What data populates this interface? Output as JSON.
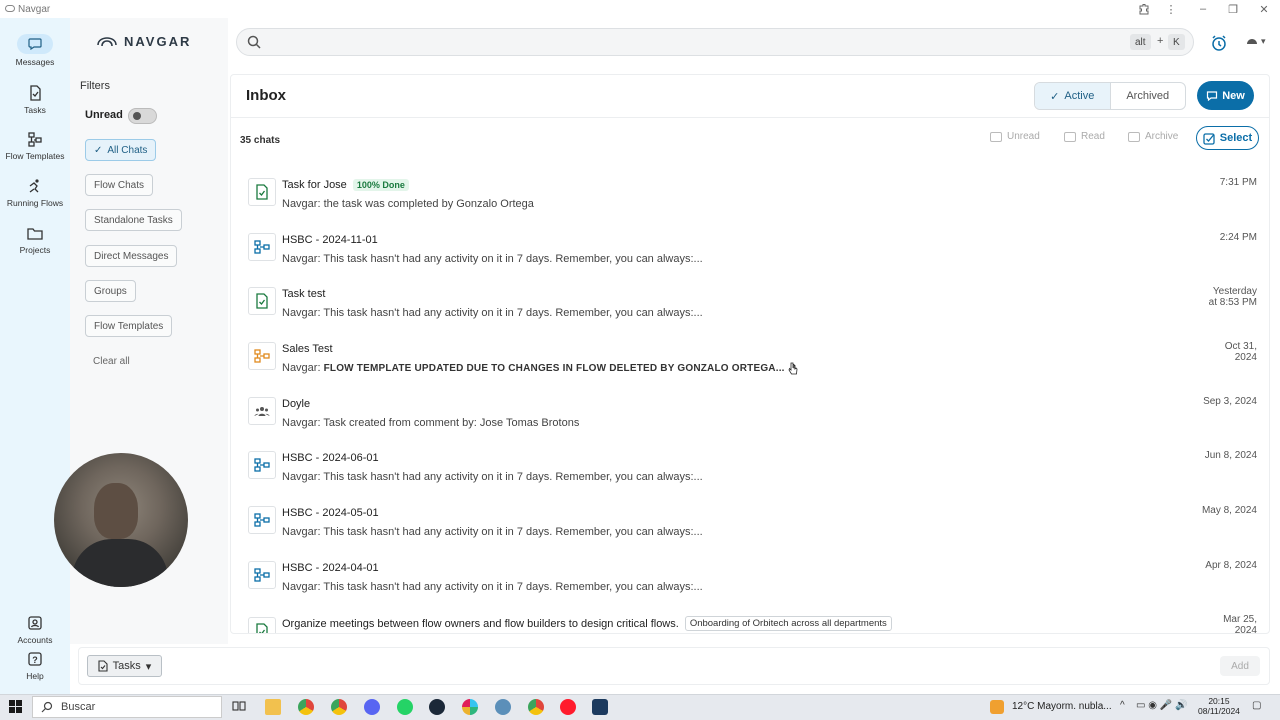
{
  "window": {
    "title": "Navgar"
  },
  "rail": {
    "items": [
      {
        "label": "Messages",
        "icon": "message-icon"
      },
      {
        "label": "Tasks",
        "icon": "task-icon"
      },
      {
        "label": "Flow Templates",
        "icon": "flow-template-icon"
      },
      {
        "label": "Running Flows",
        "icon": "running-flow-icon"
      },
      {
        "label": "Projects",
        "icon": "folder-icon"
      }
    ],
    "bottom": [
      {
        "label": "Accounts",
        "icon": "account-icon"
      },
      {
        "label": "Help",
        "icon": "help-icon"
      }
    ]
  },
  "brand": {
    "name": "NAVGAR"
  },
  "filters": {
    "title": "Filters",
    "unread_label": "Unread",
    "chips": [
      "All Chats",
      "Flow Chats",
      "Standalone Tasks",
      "Direct Messages",
      "Groups",
      "Flow Templates"
    ],
    "clear_label": "Clear all"
  },
  "search": {
    "placeholder": "",
    "shortcut_key1": "alt",
    "shortcut_plus": "+",
    "shortcut_key2": "K"
  },
  "inbox": {
    "title": "Inbox",
    "tab_active": "Active",
    "tab_archived": "Archived",
    "new_label": "New",
    "count": "35 chats",
    "actions": {
      "unread": "Unread",
      "read": "Read",
      "archive": "Archive",
      "select": "Select"
    }
  },
  "chats": [
    {
      "title": "Task for Jose",
      "badge": "100% Done",
      "msg": "Navgar: the task was completed by Gonzalo Ortega",
      "time1": "7:31 PM",
      "time2": "",
      "icon": "task-done-icon"
    },
    {
      "title": "HSBC - 2024-11-01",
      "msg": "Navgar: This task hasn't had any activity on it in 7 days. Remember, you can always:...",
      "time1": "2:24 PM",
      "time2": "",
      "icon": "flow-icon"
    },
    {
      "title": "Task test",
      "msg": "Navgar: This task hasn't had any activity on it in 7 days. Remember, you can always:...",
      "time1": "Yesterday",
      "time2": "at 8:53 PM",
      "icon": "task-done-icon"
    },
    {
      "title": "Sales Test",
      "msg_prefix": "Navgar: ",
      "msg_bold": "FLOW TEMPLATE UPDATED DUE TO CHANGES IN FLOW DELETED BY GONZALO ORTEGA...",
      "time1": "Oct 31,",
      "time2": "2024",
      "icon": "flow-template-icon"
    },
    {
      "title": "Doyle",
      "msg": "Navgar: Task created from comment by: Jose Tomas Brotons",
      "time1": "Sep 3, 2024",
      "time2": "",
      "icon": "group-icon"
    },
    {
      "title": "HSBC - 2024-06-01",
      "msg": "Navgar: This task hasn't had any activity on it in 7 days. Remember, you can always:...",
      "time1": "Jun 8, 2024",
      "time2": "",
      "icon": "flow-icon"
    },
    {
      "title": "HSBC - 2024-05-01",
      "msg": "Navgar: This task hasn't had any activity on it in 7 days. Remember, you can always:...",
      "time1": "May 8, 2024",
      "time2": "",
      "icon": "flow-icon"
    },
    {
      "title": "HSBC - 2024-04-01",
      "msg": "Navgar: This task hasn't had any activity on it in 7 days. Remember, you can always:...",
      "time1": "Apr 8, 2024",
      "time2": "",
      "icon": "flow-icon"
    },
    {
      "title": "Organize meetings between flow owners and flow builders to design critical flows.",
      "tag": "Onboarding of Orbitech across all departments",
      "msg": "",
      "time1": "Mar 25,",
      "time2": "2024",
      "icon": "task-done-icon"
    }
  ],
  "composer": {
    "type_label": "Tasks",
    "add_label": "Add"
  },
  "taskbar": {
    "search_label": "Buscar",
    "weather": "12°C  Mayorm. nubla...",
    "time": "20:15",
    "date": "08/11/2024"
  },
  "colors": {
    "accent": "#0b6ea8",
    "rail_bg": "#e9f6fd",
    "done_badge": "#1a7a3f",
    "flow_template": "#e08a1e"
  }
}
